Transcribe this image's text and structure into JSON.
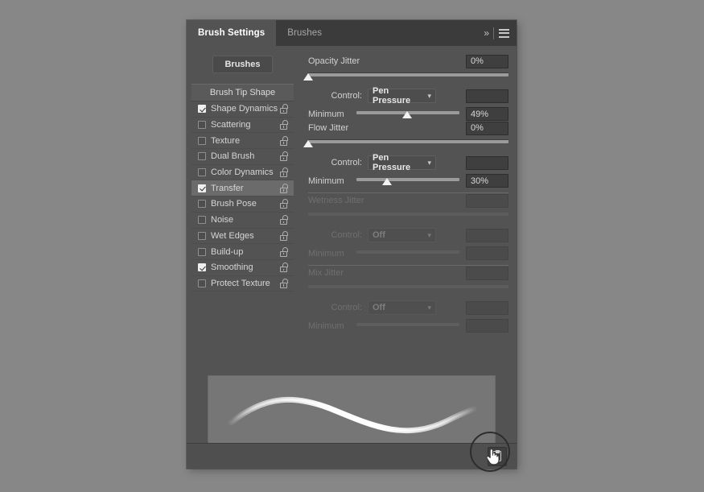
{
  "panel": {
    "tabs": [
      {
        "label": "Brush Settings",
        "active": true
      },
      {
        "label": "Brushes",
        "active": false
      }
    ],
    "collapse_icon": "chevrons-right-icon",
    "menu_icon": "hamburger-menu-icon"
  },
  "sidebar": {
    "brushes_button": "Brushes",
    "tip_shape": "Brush Tip Shape",
    "items": [
      {
        "label": "Shape Dynamics",
        "checked": true,
        "selected": false,
        "lock": "unlocked-padlock-icon"
      },
      {
        "label": "Scattering",
        "checked": false,
        "selected": false,
        "lock": "unlocked-padlock-icon"
      },
      {
        "label": "Texture",
        "checked": false,
        "selected": false,
        "lock": "unlocked-padlock-icon"
      },
      {
        "label": "Dual Brush",
        "checked": false,
        "selected": false,
        "lock": "unlocked-padlock-icon"
      },
      {
        "label": "Color Dynamics",
        "checked": false,
        "selected": false,
        "lock": "unlocked-padlock-icon"
      },
      {
        "label": "Transfer",
        "checked": true,
        "selected": true,
        "lock": "unlocked-padlock-icon"
      },
      {
        "label": "Brush Pose",
        "checked": false,
        "selected": false,
        "lock": "unlocked-padlock-icon"
      },
      {
        "label": "Noise",
        "checked": false,
        "selected": false,
        "lock": "unlocked-padlock-icon"
      },
      {
        "label": "Wet Edges",
        "checked": false,
        "selected": false,
        "lock": "unlocked-padlock-icon"
      },
      {
        "label": "Build-up",
        "checked": false,
        "selected": false,
        "lock": "unlocked-padlock-icon"
      },
      {
        "label": "Smoothing",
        "checked": true,
        "selected": false,
        "lock": "unlocked-padlock-icon"
      },
      {
        "label": "Protect Texture",
        "checked": false,
        "selected": false,
        "lock": "unlocked-padlock-icon"
      }
    ]
  },
  "controls": {
    "control_label": "Control:",
    "minimum_label": "Minimum",
    "groups": [
      {
        "id": "opacity-jitter",
        "title": "Opacity Jitter",
        "value": "0%",
        "slider_percent": 0,
        "control_value": "Pen Pressure",
        "control_extra_value": "",
        "minimum_value": "49%",
        "minimum_percent": 49,
        "disabled": false
      },
      {
        "id": "flow-jitter",
        "title": "Flow Jitter",
        "value": "0%",
        "slider_percent": 0,
        "control_value": "Pen Pressure",
        "control_extra_value": "",
        "minimum_value": "30%",
        "minimum_percent": 30,
        "disabled": false
      },
      {
        "id": "wetness-jitter",
        "title": "Wetness Jitter",
        "value": "",
        "slider_percent": 0,
        "control_value": "Off",
        "control_extra_value": "",
        "minimum_value": "",
        "minimum_percent": 0,
        "disabled": true
      },
      {
        "id": "mix-jitter",
        "title": "Mix Jitter",
        "value": "",
        "slider_percent": 0,
        "control_value": "Off",
        "control_extra_value": "",
        "minimum_value": "",
        "minimum_percent": 0,
        "disabled": true
      }
    ]
  },
  "preview": {
    "name": "brush-stroke-preview"
  },
  "bottom_bar": {
    "new_brush_icon": "new-brush-preset-icon"
  },
  "colors": {
    "panel_bg": "#535353",
    "tabbar_bg": "#3b3b3b",
    "selection": "#6b6b6b",
    "text": "#d6d6d6",
    "desktop_bg": "#878787"
  }
}
